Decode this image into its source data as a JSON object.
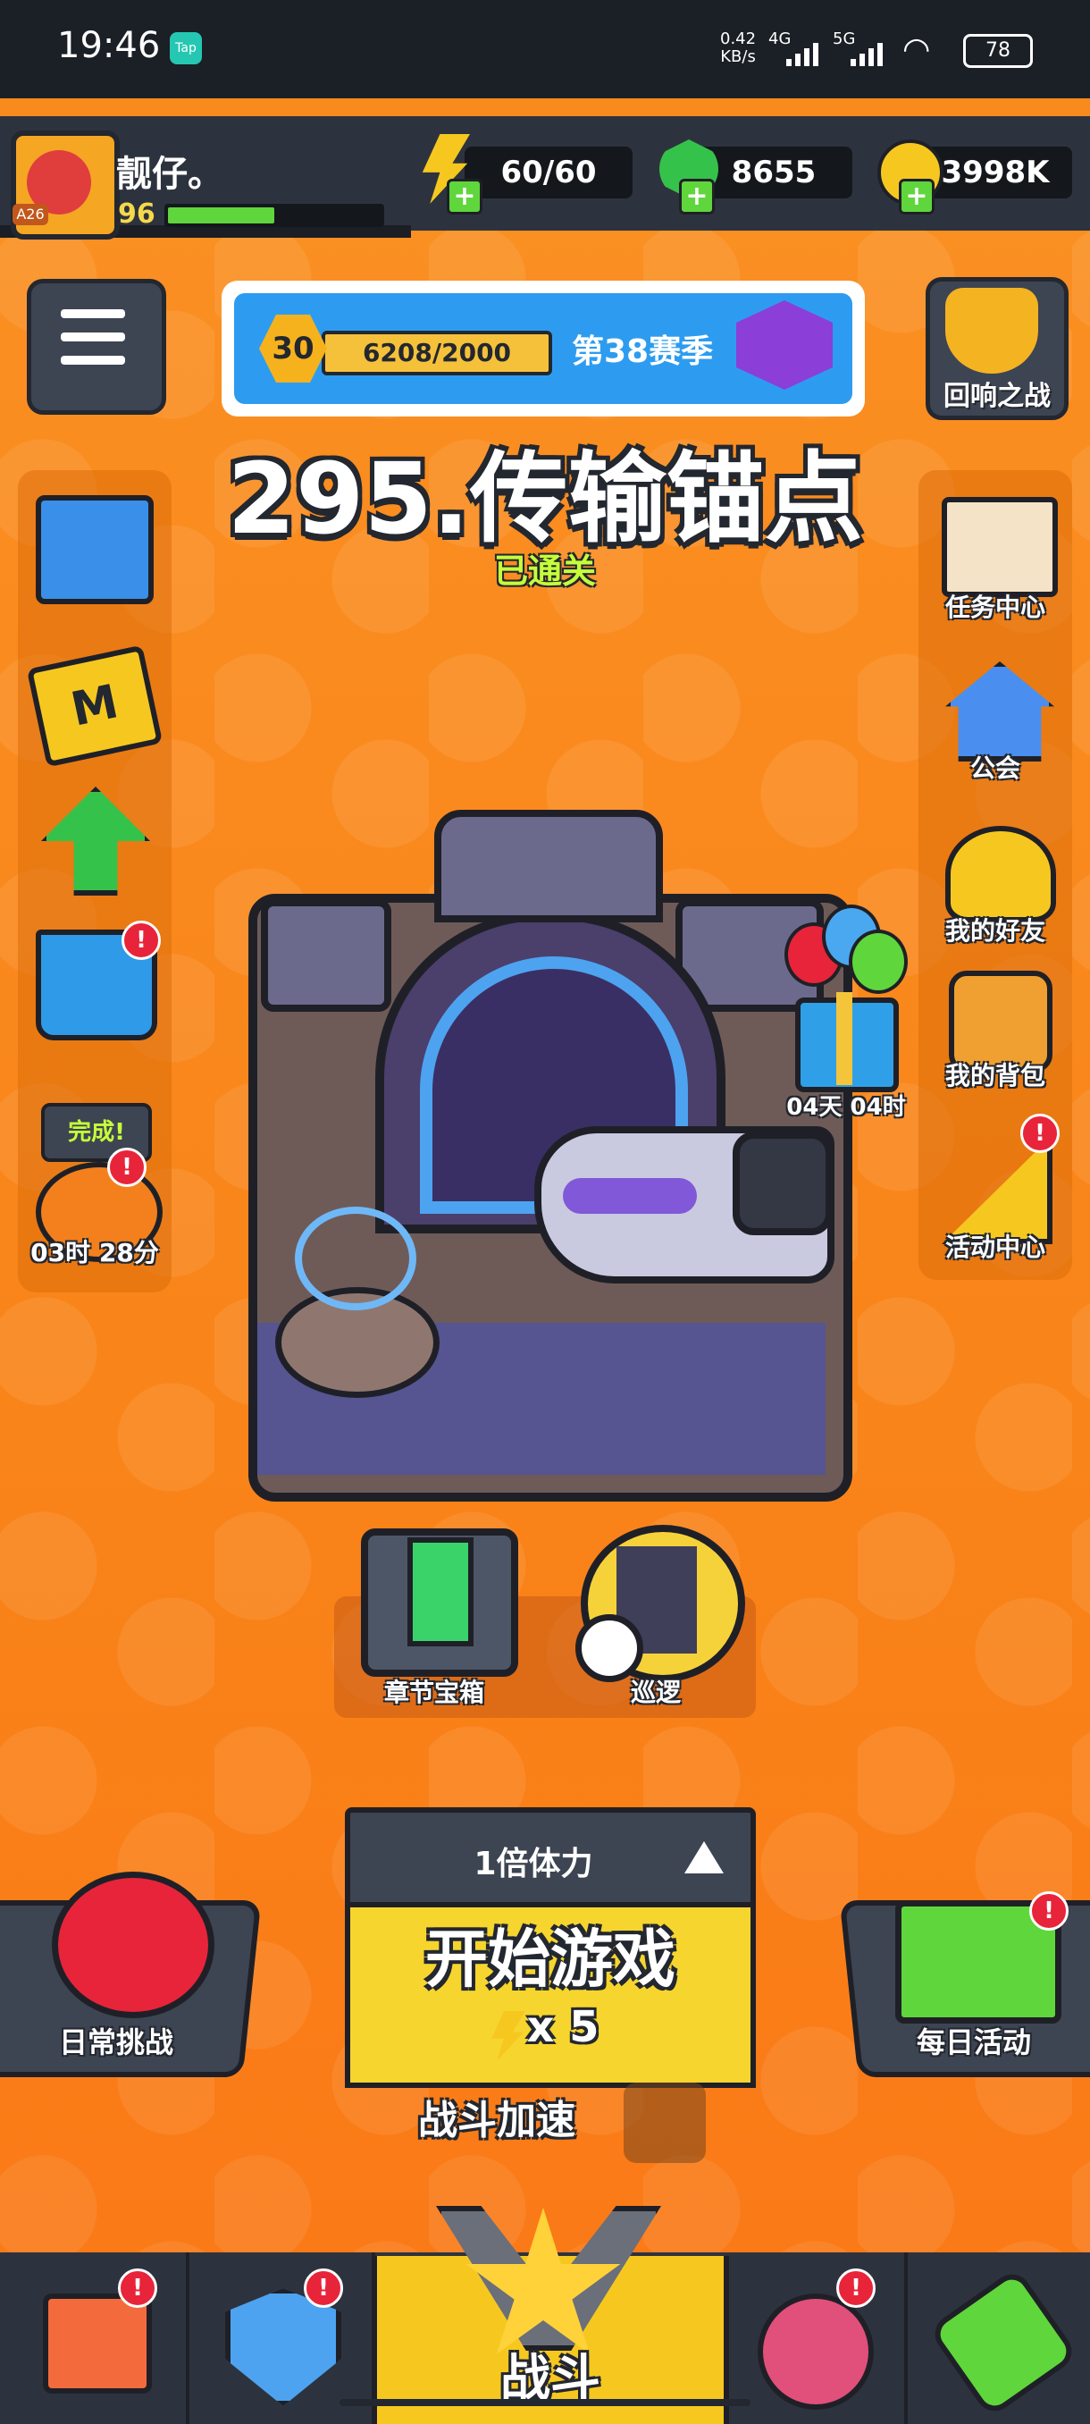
{
  "status_bar": {
    "time": "19:46",
    "tap_badge": "Tap",
    "net_speed_value": "0.42",
    "net_speed_unit": "KB/s",
    "signal_1": "4G",
    "signal_2": "5G",
    "battery": "78"
  },
  "player": {
    "name": "靓仔。",
    "level": "96",
    "avatar_badge": "A26",
    "xp_fraction": 0.5
  },
  "resources": {
    "energy": "60/60",
    "gems": "8655",
    "coins": "3998K"
  },
  "season": {
    "level": "30",
    "progress": "6208/2000",
    "label": "第38赛季"
  },
  "stage": {
    "title": "295.传输锚点",
    "status": "已通关"
  },
  "left_column": {
    "pumpkin_status": "完成!",
    "pumpkin_timer": "03时 28分"
  },
  "right_column": {
    "echo_battle": "回响之战",
    "task_center": "任务中心",
    "guild": "公会",
    "friends": "我的好友",
    "backpack": "我的背包",
    "event_center": "活动中心"
  },
  "gift": {
    "timer": "04天 04时"
  },
  "sub_actions": {
    "chapter_chest": "章节宝箱",
    "patrol": "巡逻"
  },
  "start_panel": {
    "multiplier": "1倍体力",
    "start_label": "开始游戏",
    "cost": "x 5",
    "boost_label": "战斗加速"
  },
  "side_buttons": {
    "daily_challenge": "日常挑战",
    "daily_events": "每日活动"
  },
  "bottom_nav": {
    "battle": "战斗"
  },
  "alert_mark": "!"
}
